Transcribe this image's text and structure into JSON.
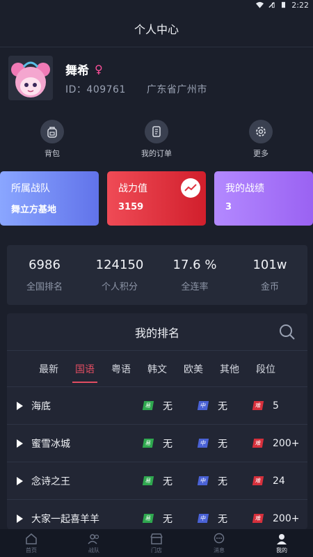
{
  "status_bar": {
    "time": "2:22"
  },
  "header": {
    "title": "个人中心"
  },
  "profile": {
    "name": "舞希",
    "gender_symbol": "♀",
    "id_label": "ID：409761",
    "location": "广东省广州市"
  },
  "quick_actions": [
    {
      "label": "背包",
      "icon": "backpack-icon"
    },
    {
      "label": "我的订单",
      "icon": "order-icon"
    },
    {
      "label": "更多",
      "icon": "gear-icon"
    }
  ],
  "cards": [
    {
      "title": "所属战队",
      "value": "舞立方基地"
    },
    {
      "title": "战力值",
      "value": "3159"
    },
    {
      "title": "我的战绩",
      "value": "3"
    }
  ],
  "overview": [
    {
      "value": "6986",
      "label": "全国排名"
    },
    {
      "value": "124150",
      "label": "个人积分"
    },
    {
      "value": "17.6 %",
      "label": "全连率"
    },
    {
      "value": "101w",
      "label": "金币"
    }
  ],
  "ranking": {
    "title": "我的排名",
    "tabs": [
      "最新",
      "国语",
      "粤语",
      "韩文",
      "欧美",
      "其他",
      "段位"
    ],
    "active_tab": "国语",
    "difficulty_labels": {
      "easy": "易",
      "mid": "中",
      "hard": "难"
    },
    "songs": [
      {
        "name": "海底",
        "easy": "无",
        "mid": "无",
        "hard": "5"
      },
      {
        "name": "蜜雪冰城",
        "easy": "无",
        "mid": "无",
        "hard": "200+"
      },
      {
        "name": "念诗之王",
        "easy": "无",
        "mid": "无",
        "hard": "24"
      },
      {
        "name": "大家一起喜羊羊",
        "easy": "无",
        "mid": "无",
        "hard": "200+"
      }
    ]
  },
  "bottom_nav": [
    {
      "label": "首页",
      "icon": "home-icon"
    },
    {
      "label": "战队",
      "icon": "team-icon"
    },
    {
      "label": "门店",
      "icon": "store-icon"
    },
    {
      "label": "消息",
      "icon": "message-icon"
    },
    {
      "label": "我的",
      "icon": "profile-icon",
      "active": true
    }
  ]
}
